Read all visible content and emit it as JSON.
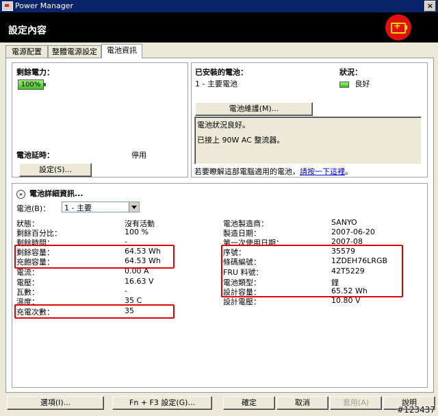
{
  "window": {
    "title": "Power Manager",
    "close_glyph": "×"
  },
  "header": {
    "title": "設定內容",
    "logo_icon": "battery-plus-icon"
  },
  "tabs": [
    {
      "label": "電源配置"
    },
    {
      "label": "整體電源設定"
    },
    {
      "label": "電池資訊",
      "active": true
    }
  ],
  "remaining": {
    "label": "剩餘電力：",
    "level_percent": 100,
    "level_text": "100%",
    "delay_label": "電池延時：",
    "delay_value": "停用",
    "settings_button": "設定(S)..."
  },
  "installed": {
    "label": "已安裝的電池：",
    "battery_name": "1 - 主要電池",
    "status_label": "狀況：",
    "status_value": "良好",
    "maintenance_button": "電池維護(M)...",
    "status_lines": [
      "電池狀況良好。",
      "已接上 90W AC 整流器。"
    ],
    "info_text": "若要瞭解這部電腦適用的電池，",
    "info_link": "請按一下這裡",
    "info_end": "。"
  },
  "details": {
    "title": "電池詳細資訊...",
    "battery_select_label": "電池(B)：",
    "battery_select_value": "1 - 主要",
    "left_rows": [
      {
        "label": "狀態：",
        "value": "沒有活動"
      },
      {
        "label": "剩餘百分比：",
        "value": "100 %"
      },
      {
        "label": "剩餘時間：",
        "value": "-"
      },
      {
        "label": "剩餘容量：",
        "value": "64.53 Wh"
      },
      {
        "label": "充飽容量：",
        "value": "64.53 Wh"
      },
      {
        "label": "電流：",
        "value": "0.00 A"
      },
      {
        "label": "電壓：",
        "value": "16.63 V"
      },
      {
        "label": "瓦數：",
        "value": "-"
      },
      {
        "label": "溫度：",
        "value": "35 C"
      },
      {
        "label": "充電次數：",
        "value": "35"
      }
    ],
    "right_rows": [
      {
        "label": "電池製造商：",
        "value": "SANYO"
      },
      {
        "label": "製造日期：",
        "value": "2007-06-20"
      },
      {
        "label": "第一次使用日期：",
        "value": "2007-08"
      },
      {
        "label": "序號：",
        "value": "35579"
      },
      {
        "label": "條碼編號：",
        "value": "1ZDEH76LRGB"
      },
      {
        "label": "FRU 料號：",
        "value": "42T5229"
      },
      {
        "label": "電池類型：",
        "value": "鋰"
      },
      {
        "label": "設計容量：",
        "value": "65.52 Wh"
      },
      {
        "label": "設計電壓：",
        "value": "10.80 V"
      }
    ]
  },
  "footer": {
    "options": "選項(I)...",
    "fn_f3": "Fn + F3 設定(G)...",
    "ok": "確定",
    "cancel": "取消",
    "apply": "套用(A)",
    "help": "說明"
  },
  "watermark": "#123437",
  "colors": {
    "highlight": "#e00000",
    "title_bar": "#0a246a",
    "logo": "#e01010",
    "link": "#0000cc"
  }
}
